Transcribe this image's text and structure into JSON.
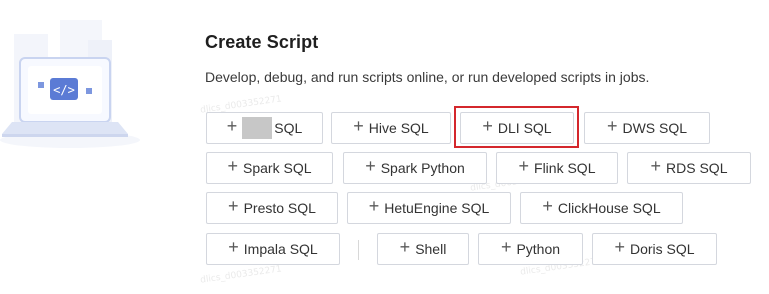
{
  "title": "Create Script",
  "description": "Develop, debug, and run scripts online, or run developed scripts in jobs.",
  "code_icon_symbol": "</>",
  "buttons": [
    {
      "label": "SQL",
      "has_mask": true
    },
    {
      "label": "Hive SQL"
    },
    {
      "label": "DLI SQL",
      "highlighted": true
    },
    {
      "label": "DWS SQL"
    },
    {
      "label": "Spark SQL"
    },
    {
      "label": "Spark Python"
    },
    {
      "label": "Flink SQL"
    },
    {
      "label": "RDS SQL"
    },
    {
      "label": "Presto SQL"
    },
    {
      "label": "HetuEngine SQL"
    },
    {
      "label": "ClickHouse SQL"
    },
    {
      "label": "Impala SQL"
    },
    {
      "label": "Shell"
    },
    {
      "label": "Python"
    },
    {
      "label": "Doris SQL"
    }
  ],
  "colors": {
    "highlight_border": "#d4272c",
    "button_border": "#d4d7de",
    "illustration_blue": "#5b7bd5"
  }
}
